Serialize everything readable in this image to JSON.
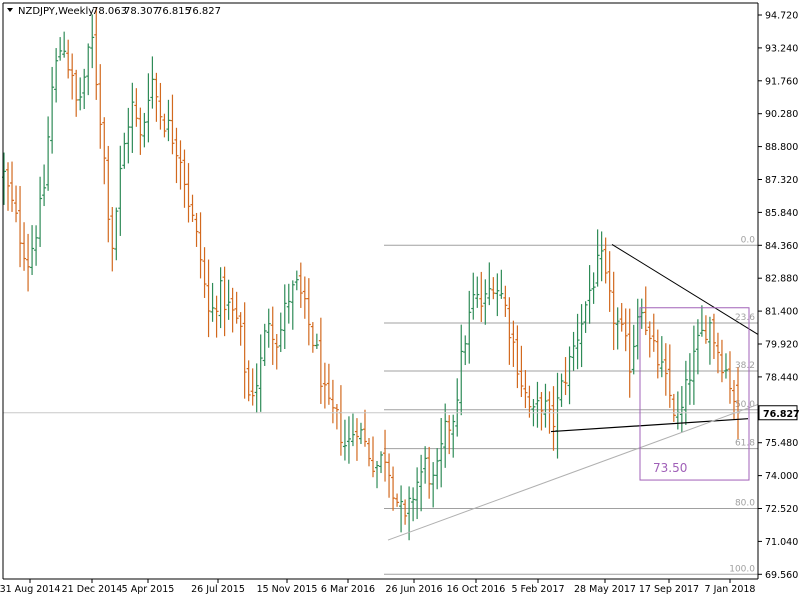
{
  "header": {
    "symbol": "NZDJPY,Weekly",
    "open": "78.063",
    "high": "78.307",
    "low": "76.815",
    "close": "76.827",
    "collapse_icon": "triangle-down-icon"
  },
  "colors": {
    "background": "#ffffff",
    "up_bar": "#2e8b57",
    "down_bar": "#d2691e",
    "fib_line": "#a0a0a0",
    "trendline": "#000000",
    "box": "#a060b8",
    "box_text": "#a060b8",
    "price_label_bg": "#ffffff",
    "axis": "#000000"
  },
  "chart_data": {
    "type": "ohlc",
    "timeframe": "Weekly",
    "symbol": "NZDJPY",
    "ylim": [
      69.2,
      95.4
    ],
    "y_ticks": [
      "94.720",
      "93.240",
      "91.760",
      "90.280",
      "88.800",
      "87.320",
      "85.840",
      "84.360",
      "82.880",
      "81.400",
      "79.920",
      "78.440",
      "76.960",
      "75.480",
      "74.000",
      "72.520",
      "71.040",
      "69.560"
    ],
    "x_ticks": [
      "31 Aug 2014",
      "21 Dec 2014",
      "5 Apr 2015",
      "26 Jul 2015",
      "15 Nov 2015",
      "6 Mar 2016",
      "26 Jun 2016",
      "16 Oct 2016",
      "5 Feb 2017",
      "28 May 2017",
      "17 Sep 2017",
      "7 Jan 2018"
    ],
    "current_price": "76.827",
    "price_path": [
      [
        0,
        87.5
      ],
      [
        3,
        85.0
      ],
      [
        5,
        83.6
      ],
      [
        8,
        86.5
      ],
      [
        10,
        91.8
      ],
      [
        12,
        93.7
      ],
      [
        15,
        90.5
      ],
      [
        18,
        93.6
      ],
      [
        20,
        89.5
      ],
      [
        22,
        84.2
      ],
      [
        24,
        88.0
      ],
      [
        26,
        90.8
      ],
      [
        28,
        89.0
      ],
      [
        30,
        92.1
      ],
      [
        32,
        90.3
      ],
      [
        34,
        89.5
      ],
      [
        36,
        88.5
      ],
      [
        38,
        86.0
      ],
      [
        40,
        84.0
      ],
      [
        42,
        81.0
      ],
      [
        44,
        82.3
      ],
      [
        46,
        81.5
      ],
      [
        48,
        80.8
      ],
      [
        50,
        77.6
      ],
      [
        52,
        78.4
      ],
      [
        54,
        81.2
      ],
      [
        56,
        80.0
      ],
      [
        58,
        82.0
      ],
      [
        60,
        82.5
      ],
      [
        62,
        81.0
      ],
      [
        64,
        79.4
      ],
      [
        66,
        77.0
      ],
      [
        68,
        76.5
      ],
      [
        70,
        75.2
      ],
      [
        72,
        76.4
      ],
      [
        74,
        75.3
      ],
      [
        76,
        74.4
      ],
      [
        78,
        75.0
      ],
      [
        80,
        73.1
      ],
      [
        82,
        71.8
      ],
      [
        84,
        73.5
      ],
      [
        86,
        74.5
      ],
      [
        88,
        73.5
      ],
      [
        90,
        75.8
      ],
      [
        92,
        76.8
      ],
      [
        94,
        80.0
      ],
      [
        96,
        82.0
      ],
      [
        98,
        81.6
      ],
      [
        100,
        82.8
      ],
      [
        102,
        82.0
      ],
      [
        104,
        80.0
      ],
      [
        106,
        78.0
      ],
      [
        108,
        76.6
      ],
      [
        110,
        77.4
      ],
      [
        112,
        76.2
      ],
      [
        114,
        78.0
      ],
      [
        116,
        79.4
      ],
      [
        118,
        81.0
      ],
      [
        120,
        82.6
      ],
      [
        122,
        83.7
      ],
      [
        124,
        81.5
      ],
      [
        126,
        80.5
      ],
      [
        128,
        79.0
      ],
      [
        130,
        82.2
      ],
      [
        132,
        79.9
      ],
      [
        134,
        79.0
      ],
      [
        136,
        77.6
      ],
      [
        138,
        76.3
      ],
      [
        140,
        78.5
      ],
      [
        142,
        80.0
      ],
      [
        144,
        81.0
      ],
      [
        146,
        79.6
      ],
      [
        148,
        78.5
      ],
      [
        150,
        76.9
      ]
    ],
    "fibonacci": {
      "high": 84.36,
      "low": 69.56,
      "levels": [
        {
          "label": "0.0",
          "ratio": 0.0
        },
        {
          "label": "23.6",
          "ratio": 0.236
        },
        {
          "label": "38.2",
          "ratio": 0.382
        },
        {
          "label": "50.0",
          "ratio": 0.5
        },
        {
          "label": "61.8",
          "ratio": 0.618
        },
        {
          "label": "80.0",
          "ratio": 0.8
        },
        {
          "label": "100.0",
          "ratio": 1.0
        }
      ]
    },
    "annotations": {
      "box_label": "73.50",
      "box_price_top": 81.55,
      "box_price_bottom": 73.8
    }
  }
}
